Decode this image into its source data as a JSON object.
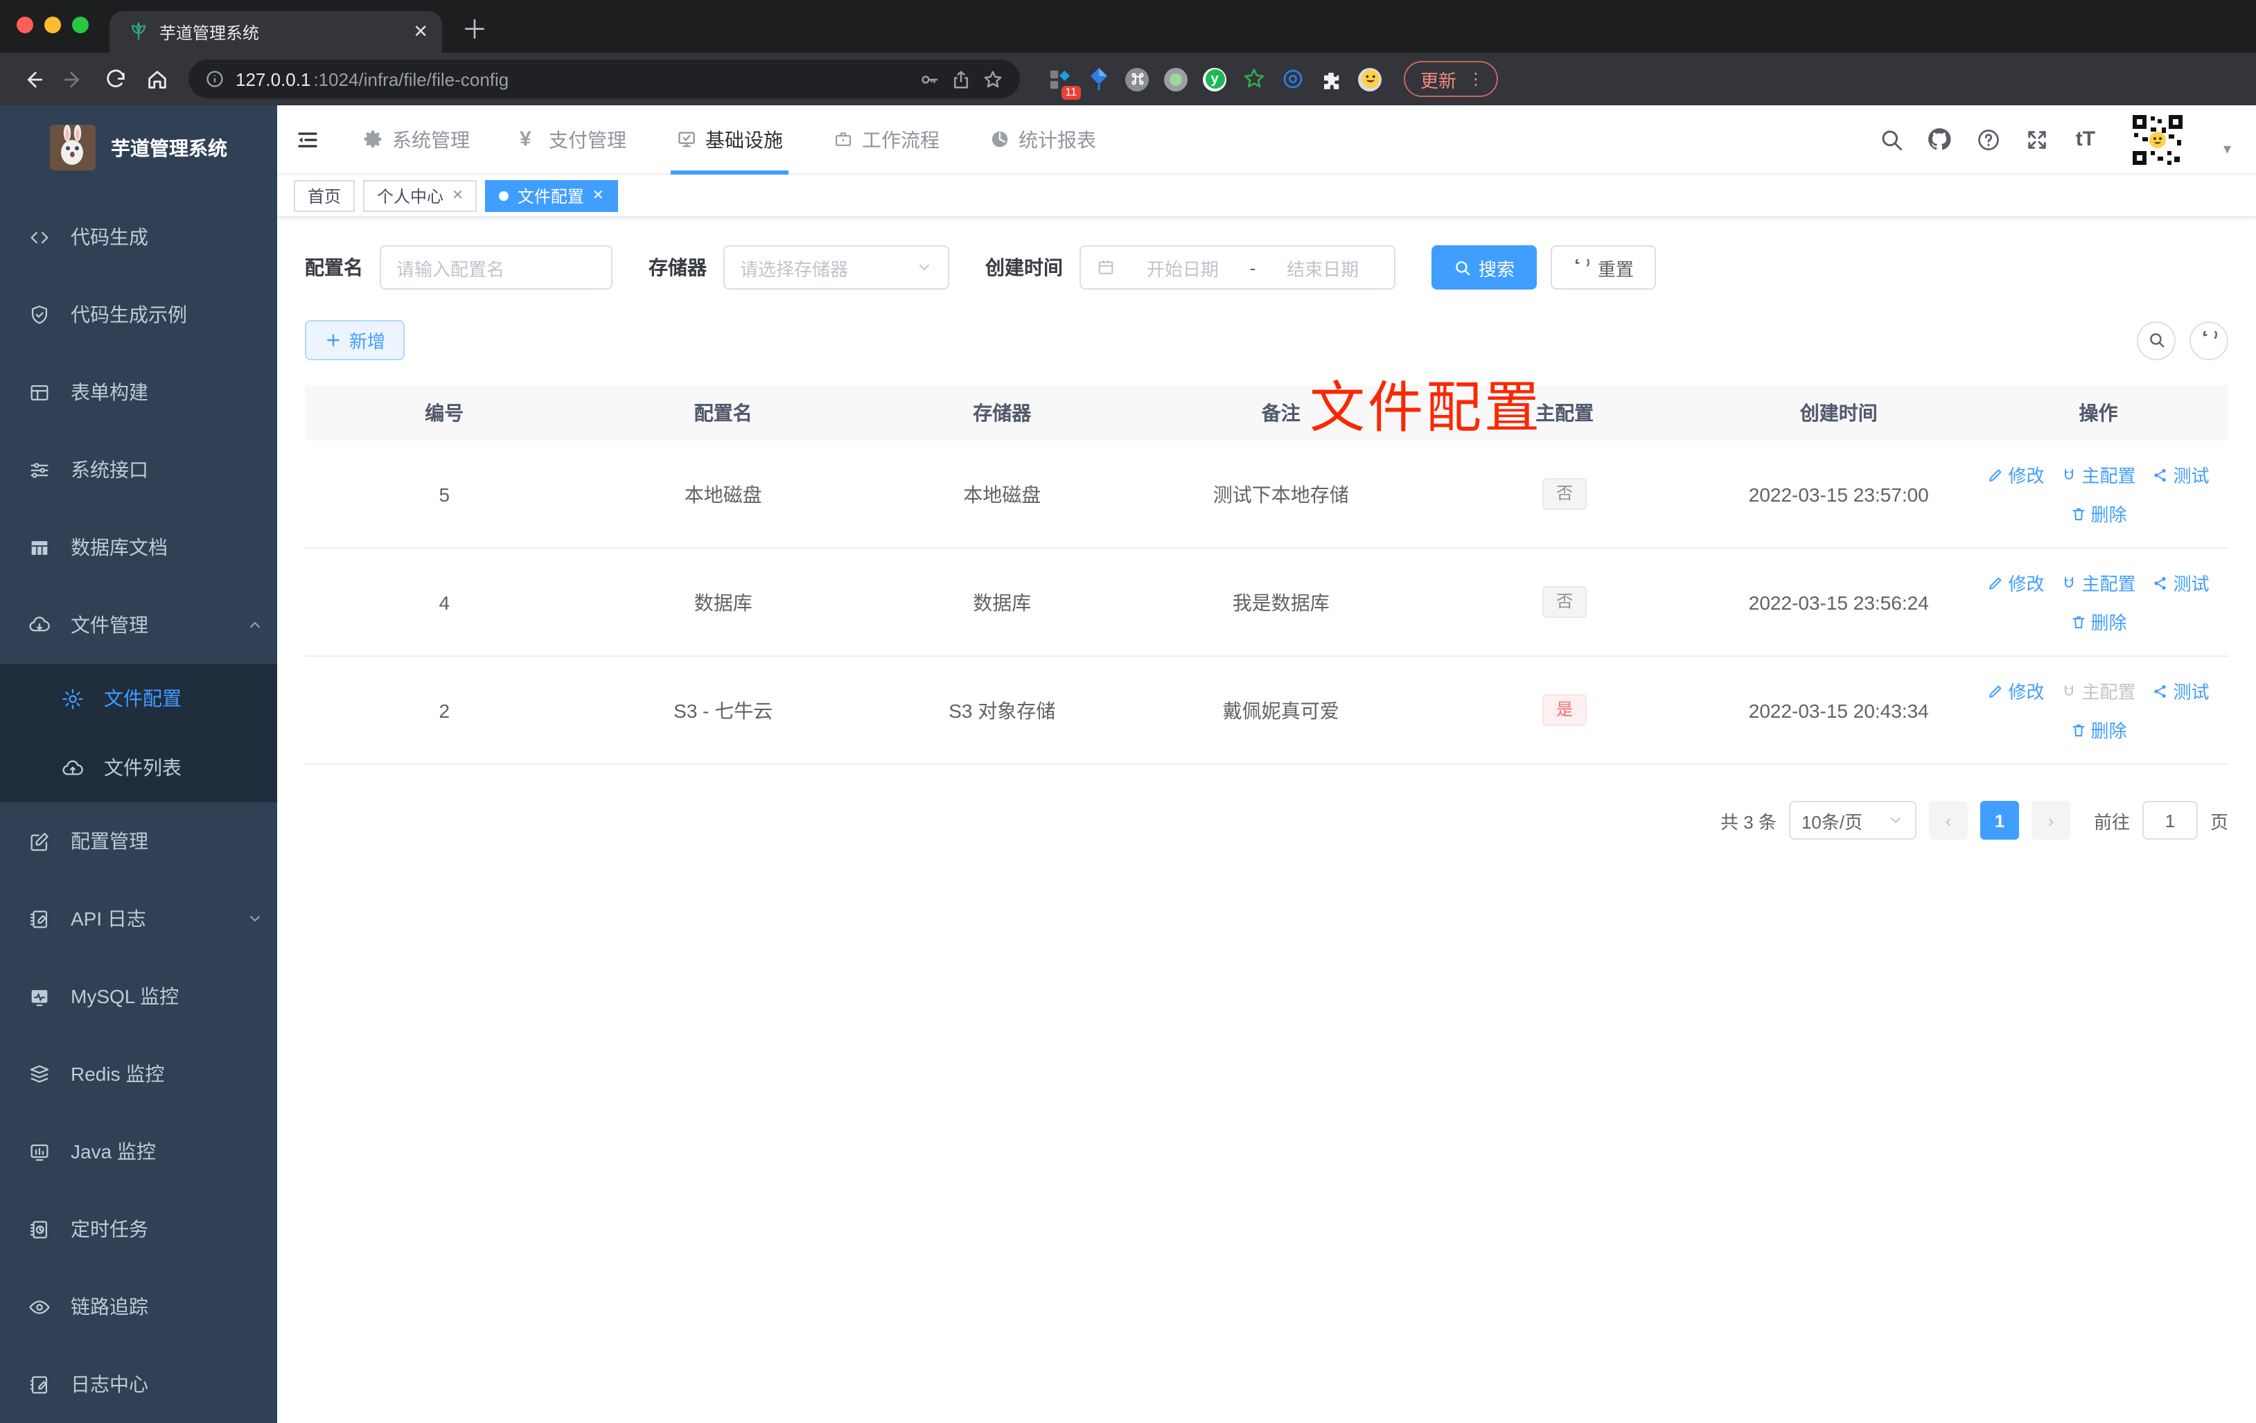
{
  "colors": {
    "primary": "#409eff",
    "annotation_red": "#fa2800",
    "sidebar_bg": "#304156",
    "submenu_bg": "#1f2d3d",
    "tag_danger": "#f56c6c"
  },
  "browser": {
    "tab_title": "芋道管理系统",
    "close_glyph": "✕",
    "new_tab_glyph": "＋",
    "url_host": "127.0.0.1",
    "url_rest": ":1024/infra/file/file-config",
    "extension_badge": "11",
    "update_button": "更新",
    "menu_dots": "⋮",
    "overflow_caret": "▾"
  },
  "sidebar": {
    "logo_title": "芋道管理系统",
    "items": [
      {
        "label": "代码生成"
      },
      {
        "label": "代码生成示例"
      },
      {
        "label": "表单构建"
      },
      {
        "label": "系统接口"
      },
      {
        "label": "数据库文档"
      },
      {
        "label": "文件管理"
      },
      {
        "label": "文件配置"
      },
      {
        "label": "文件列表"
      },
      {
        "label": "配置管理"
      },
      {
        "label": "API 日志"
      },
      {
        "label": "MySQL 监控"
      },
      {
        "label": "Redis 监控"
      },
      {
        "label": "Java 监控"
      },
      {
        "label": "定时任务"
      },
      {
        "label": "链路追踪"
      },
      {
        "label": "日志中心"
      }
    ]
  },
  "topnav": {
    "items": [
      {
        "label": "系统管理"
      },
      {
        "label": "支付管理"
      },
      {
        "label": "基础设施"
      },
      {
        "label": "工作流程"
      },
      {
        "label": "统计报表"
      }
    ]
  },
  "tags": [
    {
      "label": "首页"
    },
    {
      "label": "个人中心",
      "close": "✕"
    },
    {
      "label": "文件配置",
      "close": "✕"
    }
  ],
  "annotation": "文件配置",
  "filters": {
    "config_name_label": "配置名",
    "config_name_placeholder": "请输入配置名",
    "storage_label": "存储器",
    "storage_placeholder": "请选择存储器",
    "create_time_label": "创建时间",
    "start_date_placeholder": "开始日期",
    "range_separator": "-",
    "end_date_placeholder": "结束日期",
    "search_button": "搜索",
    "reset_button": "重置"
  },
  "toolbar": {
    "add_button": "新增"
  },
  "table": {
    "headers": [
      "编号",
      "配置名",
      "存储器",
      "备注",
      "主配置",
      "创建时间",
      "操作"
    ],
    "action_labels": {
      "edit": "修改",
      "master": "主配置",
      "test": "测试",
      "delete": "删除"
    },
    "rows": [
      {
        "id": "5",
        "name": "本地磁盘",
        "storage": "本地磁盘",
        "remark": "测试下本地存储",
        "master": "否",
        "created": "2022-03-15 23:57:00"
      },
      {
        "id": "4",
        "name": "数据库",
        "storage": "数据库",
        "remark": "我是数据库",
        "master": "否",
        "created": "2022-03-15 23:56:24"
      },
      {
        "id": "2",
        "name": "S3 - 七牛云",
        "storage": "S3 对象存储",
        "remark": "戴佩妮真可爱",
        "master": "是",
        "created": "2022-03-15 20:43:34"
      }
    ]
  },
  "pagination": {
    "total": "共 3 条",
    "page_size": "10条/页",
    "prev_glyph": "‹",
    "current_page": "1",
    "next_glyph": "›",
    "goto_label": "前往",
    "goto_value": "1",
    "page_label": "页"
  }
}
